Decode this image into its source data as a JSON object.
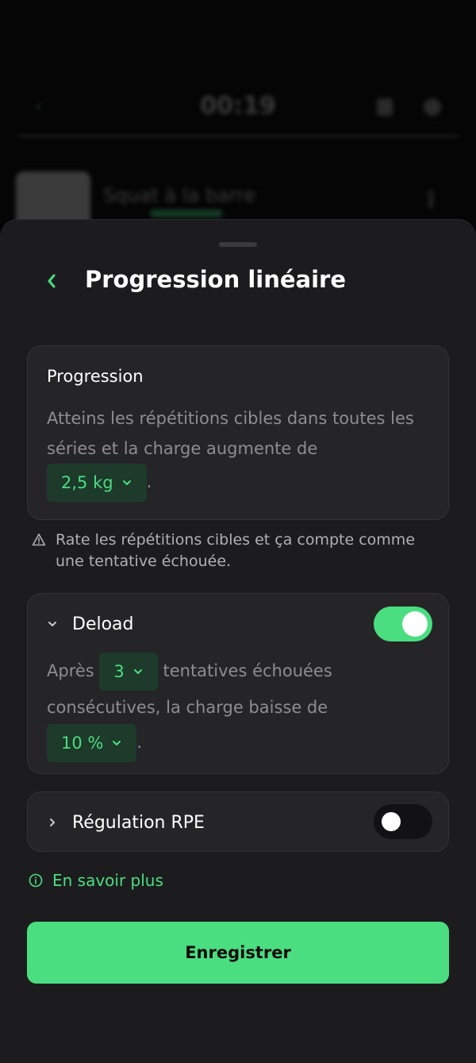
{
  "background": {
    "timer": "00:19",
    "exercise_title": "Squat à la barre"
  },
  "sheet": {
    "title": "Progression linéaire",
    "progression": {
      "title": "Progression",
      "text_before": "Atteins les répétitions cibles dans toutes les séries et la charge augmente de",
      "increment_value": "2,5 kg",
      "text_after": "."
    },
    "warning": "Rate les répétitions cibles et ça compte comme une tentative échouée.",
    "deload": {
      "label": "Deload",
      "enabled": true,
      "text_before": "Après",
      "attempts_value": "3",
      "text_middle": "tentatives échouées consécutives, la charge baisse de",
      "percent_value": "10 %",
      "text_after": "."
    },
    "rpe": {
      "label": "Régulation RPE",
      "enabled": false
    },
    "learn_more": "En savoir plus",
    "save_label": "Enregistrer"
  },
  "colors": {
    "accent": "#4ade80",
    "sheet_bg": "#1c1c1e",
    "card_bg": "#252527",
    "pill_bg": "#1d3a2a"
  }
}
